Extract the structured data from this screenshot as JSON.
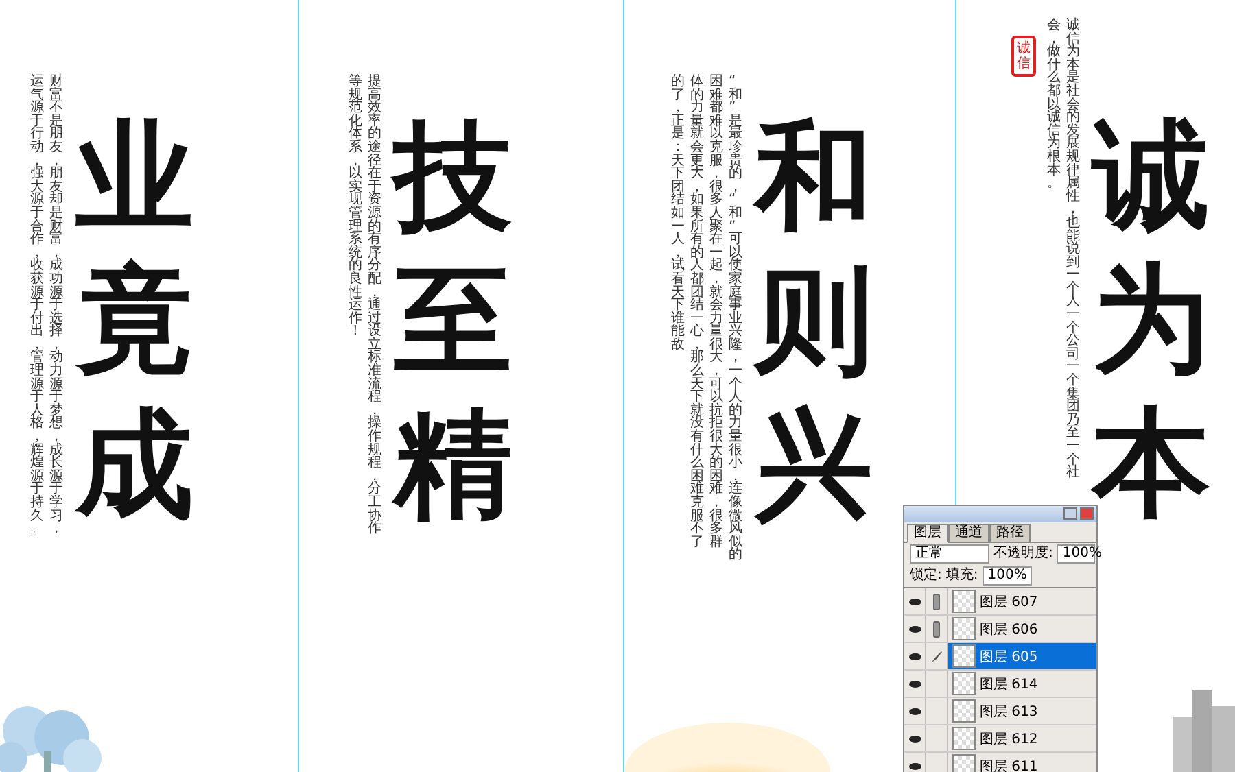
{
  "panels": [
    {
      "title": "业竟成",
      "text_columns": [
        "运气源于行动，强大源于合作，收获源于付出，管理源于人格，辉煌源于持久。",
        "财富不是朋友，朋友却是财富，成功源于选择，动力源于梦想，成长源于学习，"
      ]
    },
    {
      "title": "技至精",
      "text_columns": [
        "等规范化体系，以实现管理系统的良性运作！",
        "提高效率的途径在于资源的有序分配，通过设立标准流程，操作规程，分工协作"
      ]
    },
    {
      "title": "和则兴",
      "text_columns": [
        "的了，正是：天下团结如一人，试看天下谁能敌",
        "体的力量就会更大，如果所有的人都团结一心，那么天下就没有什么困难克服不了",
        "困难都难以克服，很多人聚在一起，就会力量很大，可以抗拒很大的困难，很多群",
        "“和”是最珍贵的，“和”可以使家庭事业兴隆，一个人的力量很小，连像微风似的"
      ]
    },
    {
      "title": "诚为本",
      "seal": "诚信",
      "text_columns": [
        "会，做什么都以诚信为根本。",
        "诚信为本是社会的发展规律属性，也能说到一个人一个公司一个集团乃至一个社"
      ]
    }
  ],
  "layers_panel": {
    "tabs": [
      {
        "label": "图层",
        "selected": true
      },
      {
        "label": "通道",
        "selected": false
      },
      {
        "label": "路径",
        "selected": false
      }
    ],
    "blend_mode": "正常",
    "opacity_label": "不透明度:",
    "opacity": "100%",
    "lock_label": "锁定:",
    "fill_label": "填充:",
    "fill": "100%",
    "layers": [
      {
        "name": "图层 607",
        "kind": "linked",
        "visible": true,
        "selected": false
      },
      {
        "name": "图层 606",
        "kind": "linked",
        "visible": true,
        "selected": false
      },
      {
        "name": "图层 605",
        "kind": "brush",
        "visible": true,
        "selected": true
      },
      {
        "name": "图层 614",
        "kind": "plain",
        "visible": true,
        "selected": false
      },
      {
        "name": "图层 613",
        "kind": "plain",
        "visible": true,
        "selected": false
      },
      {
        "name": "图层 612",
        "kind": "plain",
        "visible": true,
        "selected": false
      },
      {
        "name": "图层 611",
        "kind": "plain",
        "visible": true,
        "selected": false
      }
    ]
  }
}
